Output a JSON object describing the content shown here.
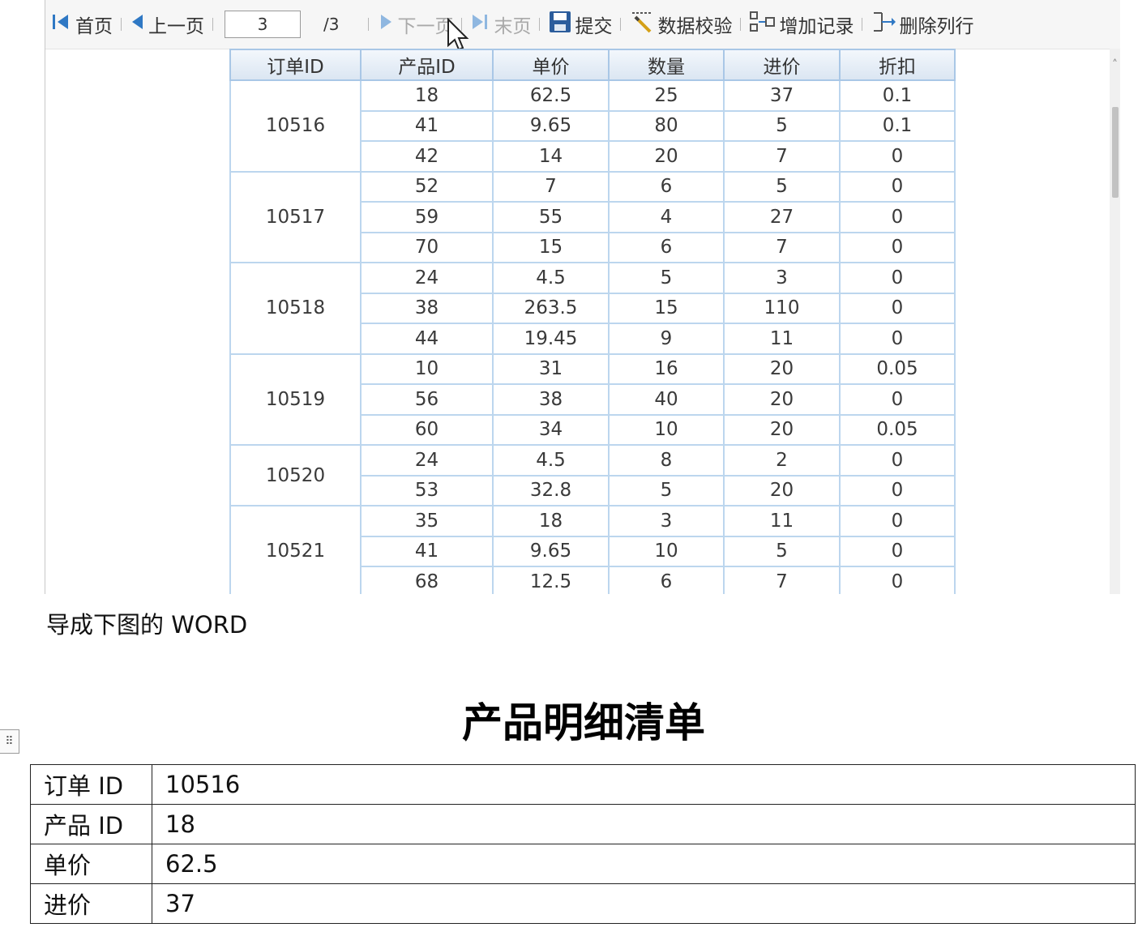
{
  "toolbar": {
    "first_label": "首页",
    "prev_label": "上一页",
    "page_value": "3",
    "page_total": "/3",
    "next_label": "下一页",
    "last_label": "末页",
    "submit_label": "提交",
    "validate_label": "数据校验",
    "add_record_label": "增加记录",
    "delete_row_label": "删除列行"
  },
  "grid": {
    "columns": [
      "订单ID",
      "产品ID",
      "单价",
      "数量",
      "进价",
      "折扣"
    ],
    "groups": [
      {
        "order_id": "10516",
        "rows": [
          [
            "18",
            "62.5",
            "25",
            "37",
            "0.1"
          ],
          [
            "41",
            "9.65",
            "80",
            "5",
            "0.1"
          ],
          [
            "42",
            "14",
            "20",
            "7",
            "0"
          ]
        ]
      },
      {
        "order_id": "10517",
        "rows": [
          [
            "52",
            "7",
            "6",
            "5",
            "0"
          ],
          [
            "59",
            "55",
            "4",
            "27",
            "0"
          ],
          [
            "70",
            "15",
            "6",
            "7",
            "0"
          ]
        ]
      },
      {
        "order_id": "10518",
        "rows": [
          [
            "24",
            "4.5",
            "5",
            "3",
            "0"
          ],
          [
            "38",
            "263.5",
            "15",
            "110",
            "0"
          ],
          [
            "44",
            "19.45",
            "9",
            "11",
            "0"
          ]
        ]
      },
      {
        "order_id": "10519",
        "rows": [
          [
            "10",
            "31",
            "16",
            "20",
            "0.05"
          ],
          [
            "56",
            "38",
            "40",
            "20",
            "0"
          ],
          [
            "60",
            "34",
            "10",
            "20",
            "0.05"
          ]
        ]
      },
      {
        "order_id": "10520",
        "rows": [
          [
            "24",
            "4.5",
            "8",
            "2",
            "0"
          ],
          [
            "53",
            "32.8",
            "5",
            "20",
            "0"
          ]
        ]
      },
      {
        "order_id": "10521",
        "rows": [
          [
            "35",
            "18",
            "3",
            "11",
            "0"
          ],
          [
            "41",
            "9.65",
            "10",
            "5",
            "0"
          ],
          [
            "68",
            "12.5",
            "6",
            "7",
            "0"
          ]
        ]
      }
    ]
  },
  "caption": "导成下图的 WORD",
  "document": {
    "title": "产品明细清单",
    "rows": [
      {
        "key": "订单 ID",
        "value": "10516"
      },
      {
        "key": "产品 ID",
        "value": "18"
      },
      {
        "key": "单价",
        "value": "62.5"
      },
      {
        "key": "进价",
        "value": "37"
      }
    ]
  },
  "colors": {
    "grid_border": "#bcd6ee",
    "header_bg": "#dbe6f2",
    "icon_blue": "#2f78c4"
  }
}
